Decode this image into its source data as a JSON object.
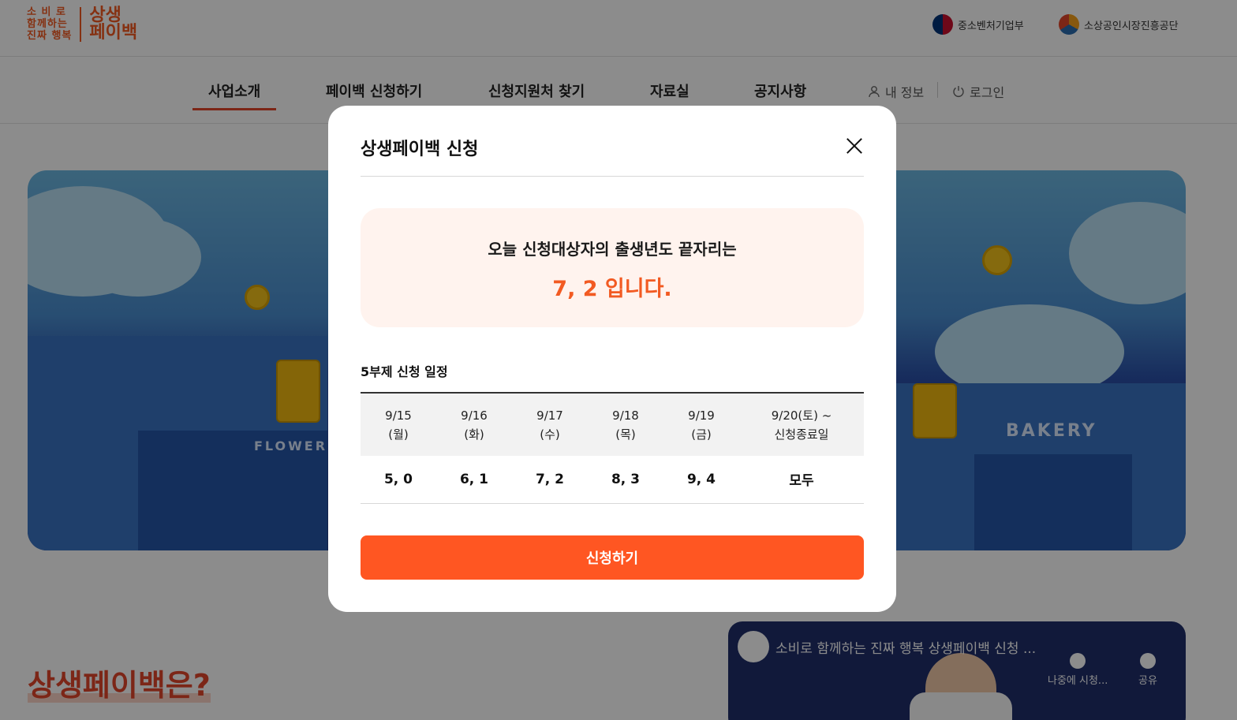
{
  "header": {
    "logo_small": [
      "소 비 로",
      "함께하는",
      "진짜 행복"
    ],
    "logo_big": [
      "상생",
      "페이백"
    ],
    "agencies": [
      {
        "label": "중소벤처기업부",
        "icon": "gov-emblem-icon"
      },
      {
        "label": "소상공인시장진흥공단",
        "icon": "sbiz-emblem-icon"
      }
    ]
  },
  "nav": {
    "items": [
      "사업소개",
      "페이백 신청하기",
      "신청지원처 찾기",
      "자료실",
      "공지사항"
    ],
    "active_index": 0,
    "my_info": "내 정보",
    "login": "로그인"
  },
  "hero": {
    "signs": [
      "FLOWER",
      "BAKERY"
    ]
  },
  "section": {
    "title": "상생페이백은?"
  },
  "video": {
    "title": "소비로 함께하는 진짜 행복 상생페이백 신청 ...",
    "actions": [
      "나중에 시청...",
      "공유"
    ]
  },
  "modal": {
    "title": "상생페이백 신청",
    "notice_line1": "오늘 신청대상자의 출생년도 끝자리는",
    "notice_line2": "7, 2 입니다.",
    "schedule_title": "5부제 신청 일정",
    "schedule": {
      "dates": [
        [
          "9/15",
          "(월)"
        ],
        [
          "9/16",
          "(화)"
        ],
        [
          "9/17",
          "(수)"
        ],
        [
          "9/18",
          "(목)"
        ],
        [
          "9/19",
          "(금)"
        ],
        [
          "9/20(토) ~",
          "신청종료일"
        ]
      ],
      "digits": [
        "5, 0",
        "6, 1",
        "7, 2",
        "8, 3",
        "9, 4",
        "모두"
      ]
    },
    "apply_label": "신청하기"
  },
  "colors": {
    "brand": "#f25a22",
    "button": "#ff5622",
    "notice_bg": "#fff3ee"
  }
}
